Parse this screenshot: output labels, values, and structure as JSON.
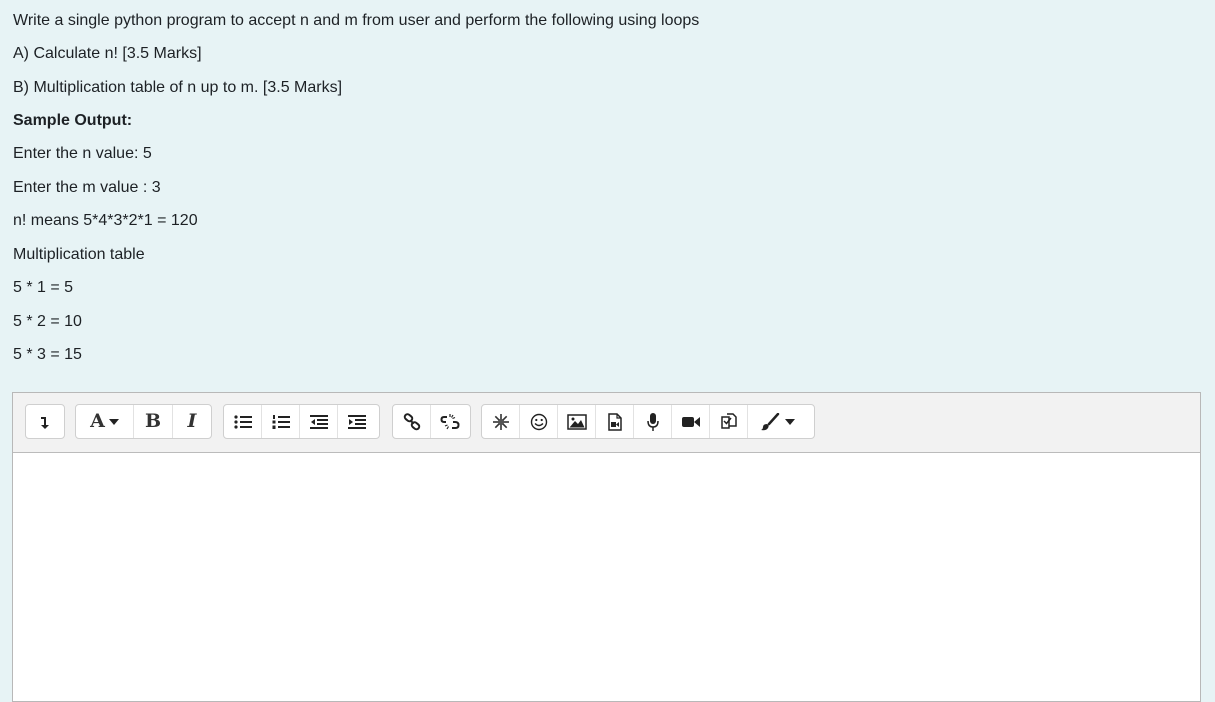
{
  "question": {
    "lines": [
      "Write a single python program to accept n and m from user and perform the following using loops",
      "A) Calculate n!  [3.5 Marks]",
      "B) Multiplication table of n up to m. [3.5 Marks]",
      "Sample Output:",
      "Enter the n value: 5",
      "Enter the m value : 3",
      "n! means 5*4*3*2*1 = 120",
      "Multiplication table",
      "5 * 1 = 5",
      "5 * 2 = 10",
      "5 * 3 = 15"
    ]
  },
  "toolbar": {
    "font_label": "A",
    "bold_label": "B",
    "italic_label": "I"
  },
  "editor": {
    "content": ""
  }
}
